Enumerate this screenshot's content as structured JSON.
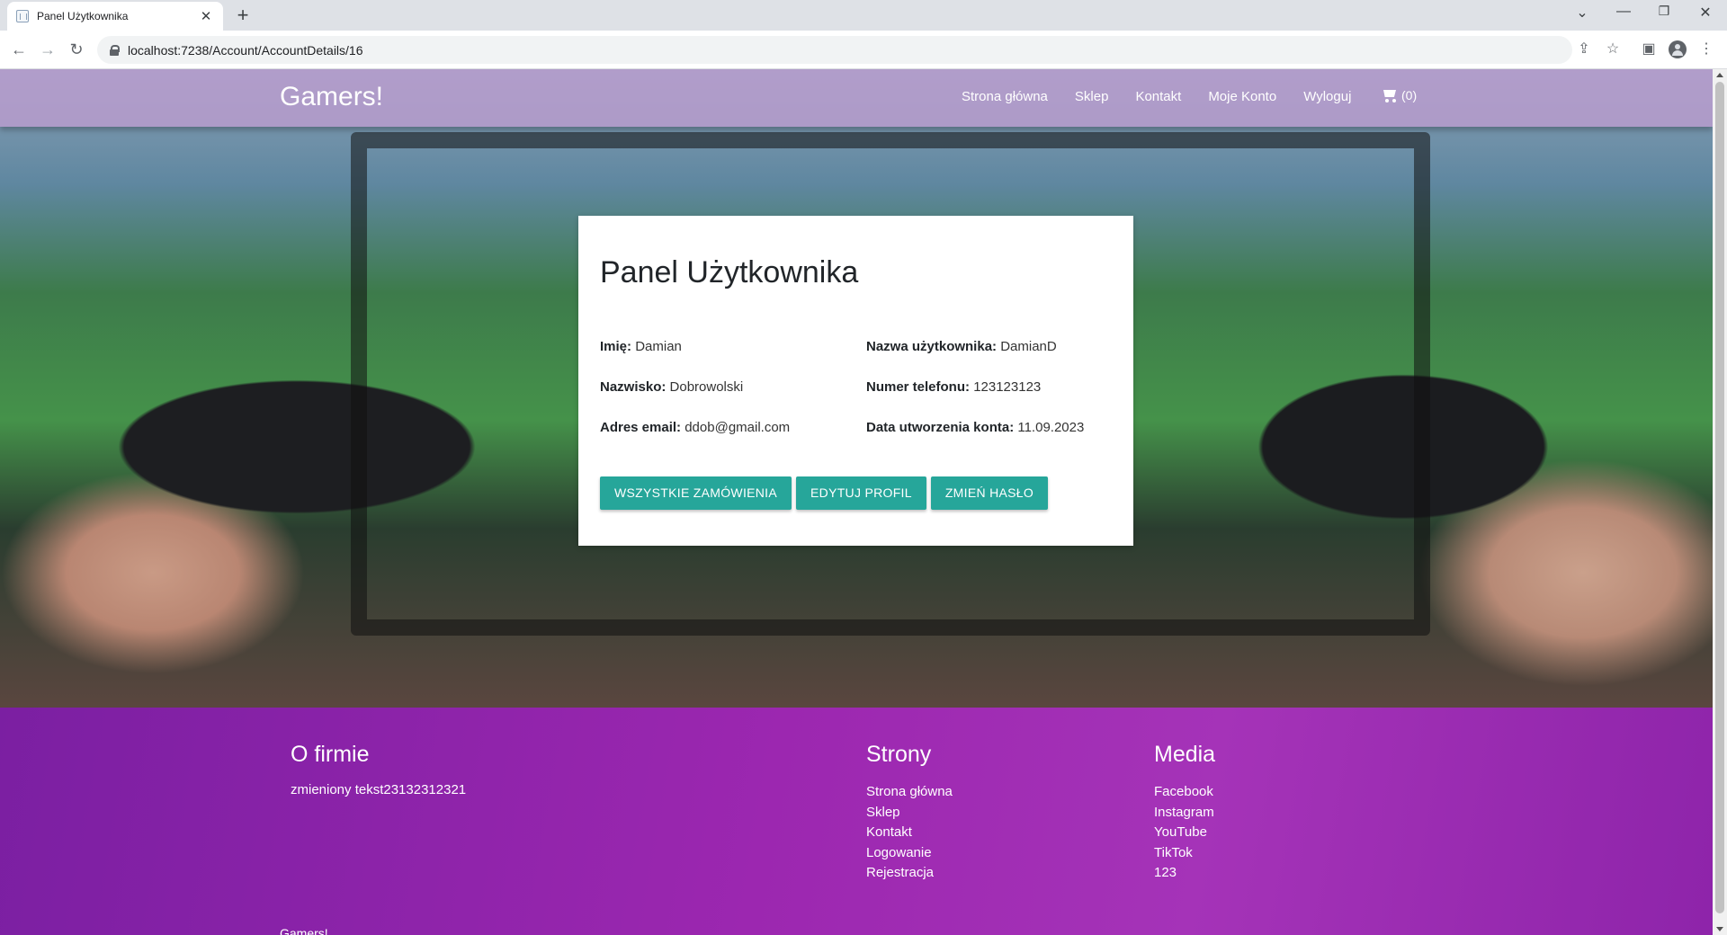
{
  "browser": {
    "tab_title": "Panel Użytkownika",
    "url": "localhost:7238/Account/AccountDetails/16",
    "icons": [
      "back-icon",
      "forward-icon",
      "reload-icon",
      "lock-icon",
      "share-icon",
      "star-icon",
      "sidepanel-icon",
      "profile-icon",
      "menu-icon",
      "minimize-icon",
      "restore-icon",
      "close-icon",
      "tab-search-icon",
      "new-tab-icon"
    ]
  },
  "navbar": {
    "brand": "Gamers!",
    "links": [
      "Strona główna",
      "Sklep",
      "Kontakt",
      "Moje Konto",
      "Wyloguj"
    ],
    "cart_count": "(0)"
  },
  "card": {
    "title": "Panel Użytkownika",
    "fields": [
      {
        "label": "Imię:",
        "value": "Damian"
      },
      {
        "label": "Nazwa użytkownika:",
        "value": "DamianD"
      },
      {
        "label": "Nazwisko:",
        "value": "Dobrowolski"
      },
      {
        "label": "Numer telefonu:",
        "value": "123123123"
      },
      {
        "label": "Adres email:",
        "value": "ddob@gmail.com"
      },
      {
        "label": "Data utworzenia konta:",
        "value": "11.09.2023"
      }
    ],
    "buttons": [
      "WSZYSTKIE ZAMÓWIENIA",
      "EDYTUJ PROFIL",
      "ZMIEŃ HASŁO"
    ]
  },
  "footer": {
    "about_title": "O firmie",
    "about_text": "zmieniony tekst23132312321",
    "pages_title": "Strony",
    "pages": [
      "Strona główna",
      "Sklep",
      "Kontakt",
      "Logowanie",
      "Rejestracja"
    ],
    "media_title": "Media",
    "media": [
      "Facebook",
      "Instagram",
      "YouTube",
      "TikTok",
      "123"
    ],
    "copyright": "Gamers!"
  },
  "colors": {
    "accent": "#26a69a",
    "navbar": "#ba9cce",
    "footer": "#9c27b0"
  }
}
